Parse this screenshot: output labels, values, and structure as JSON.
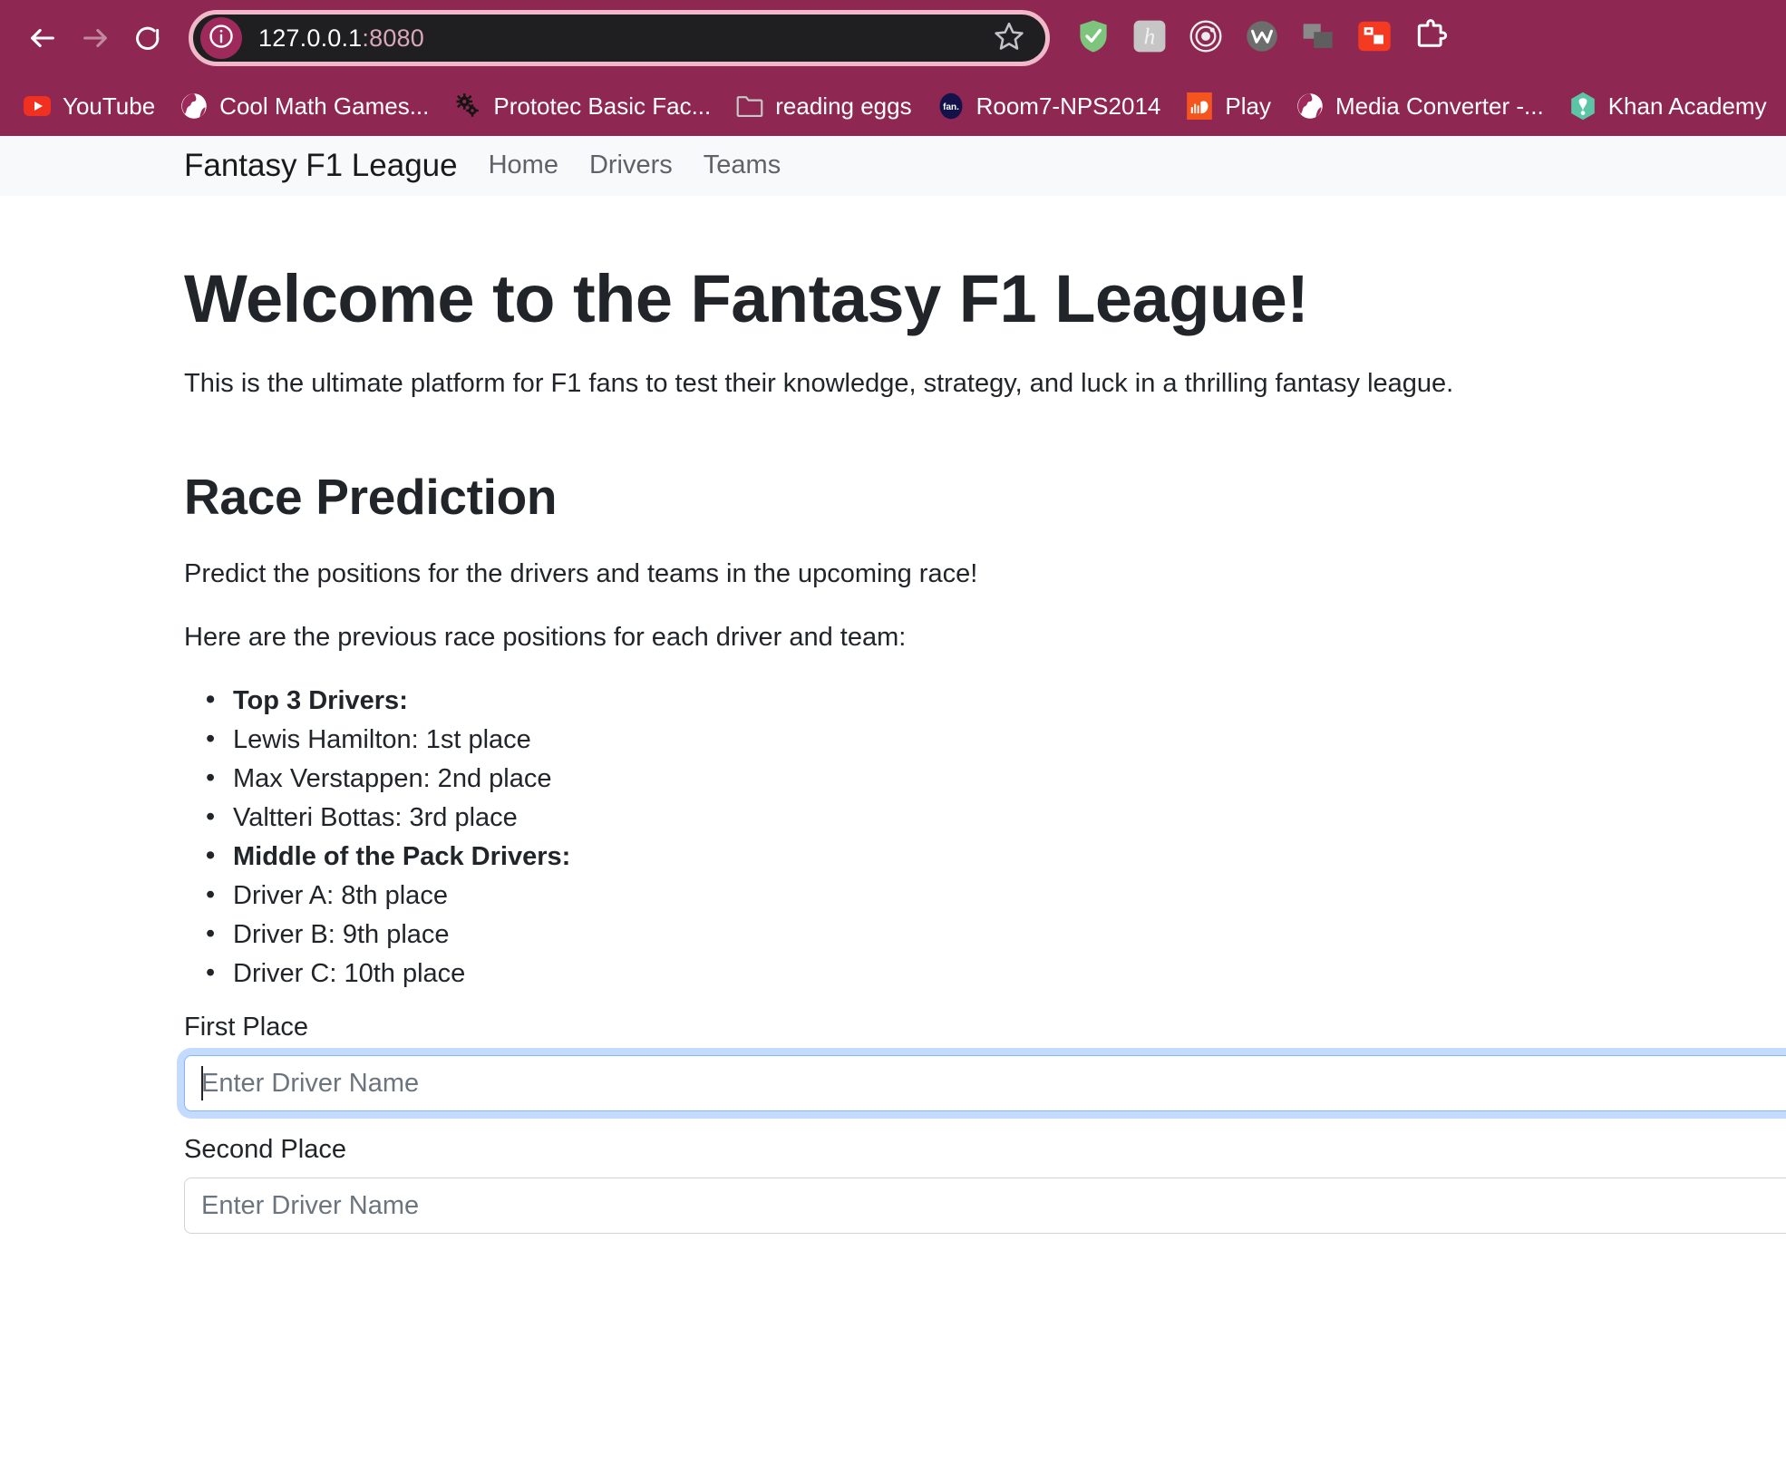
{
  "browser": {
    "back_icon": "back-arrow-icon",
    "forward_icon": "forward-arrow-icon",
    "reload_icon": "reload-icon",
    "site_info_icon": "site-info-icon",
    "url_host": "127.0.0.1",
    "url_port": ":8080",
    "bookmark_star_icon": "star-icon",
    "toolbar_color": "#8e2751",
    "omnibox_color": "#1f1f22",
    "omnibox_ring_color": "#f0b8c9",
    "extensions": [
      {
        "name": "adguard-shield-icon",
        "color": "#7dc47d"
      },
      {
        "name": "honey-icon",
        "color": "#c9c9c9"
      },
      {
        "name": "orbit-icon",
        "color": "#e8e8e8"
      },
      {
        "name": "wave-circle-icon",
        "color": "#6d6d6d"
      },
      {
        "name": "window-overlay-icon",
        "color": "#6d6d6d"
      },
      {
        "name": "picture-in-picture-icon",
        "color": "#f43a20"
      },
      {
        "name": "extensions-puzzle-icon",
        "color": "#ffffff"
      }
    ],
    "bookmarks": [
      {
        "label": "YouTube",
        "icon": "youtube-icon"
      },
      {
        "label": "Cool Math Games...",
        "icon": "globe-icon"
      },
      {
        "label": "Prototec Basic Fac...",
        "icon": "gears-icon"
      },
      {
        "label": "reading eggs",
        "icon": "folder-icon"
      },
      {
        "label": "Room7-NPS2014",
        "icon": "fan-icon"
      },
      {
        "label": "Play",
        "icon": "soundcloud-icon"
      },
      {
        "label": "Media Converter -...",
        "icon": "globe-icon"
      },
      {
        "label": "Khan Academy",
        "icon": "khan-academy-icon"
      }
    ]
  },
  "navbar": {
    "brand": "Fantasy F1 League",
    "links": [
      {
        "label": "Home"
      },
      {
        "label": "Drivers"
      },
      {
        "label": "Teams"
      }
    ],
    "background": "#f8f9fa"
  },
  "page": {
    "title": "Welcome to the Fantasy F1 League!",
    "lead": "This is the ultimate platform for F1 fans to test their knowledge, strategy, and luck in a thrilling fantasy league.",
    "section_title": "Race Prediction",
    "section_desc": "Predict the positions for the drivers and teams in the upcoming race!",
    "list_intro": "Here are the previous race positions for each driver and team:",
    "positions": [
      {
        "text": "Top 3 Drivers:",
        "bold": true
      },
      {
        "text": "Lewis Hamilton: 1st place",
        "bold": false
      },
      {
        "text": "Max Verstappen: 2nd place",
        "bold": false
      },
      {
        "text": "Valtteri Bottas: 3rd place",
        "bold": false
      },
      {
        "text": "Middle of the Pack Drivers:",
        "bold": true
      },
      {
        "text": "Driver A: 8th place",
        "bold": false
      },
      {
        "text": "Driver B: 9th place",
        "bold": false
      },
      {
        "text": "Driver C: 10th place",
        "bold": false
      }
    ],
    "form": {
      "fields": [
        {
          "label": "First Place",
          "placeholder": "Enter Driver Name",
          "value": "",
          "focused": true
        },
        {
          "label": "Second Place",
          "placeholder": "Enter Driver Name",
          "value": "",
          "focused": false
        }
      ],
      "focus_ring_color": "#86b7fe"
    }
  }
}
